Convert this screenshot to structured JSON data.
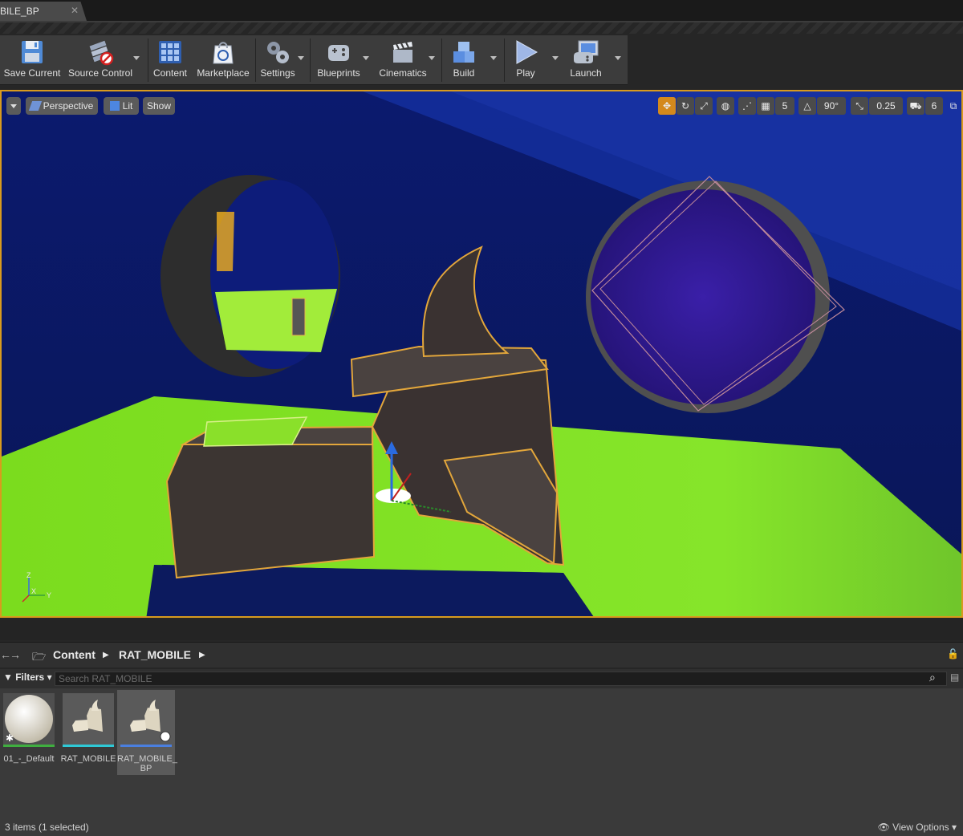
{
  "tab": {
    "title": "BILE_BP",
    "close": "✕"
  },
  "toolbar": {
    "buttons": [
      {
        "label": "Save Current",
        "icon": "save-icon"
      },
      {
        "label": "Source Control",
        "icon": "source-control-icon"
      },
      {
        "label": "Content",
        "icon": "content-icon"
      },
      {
        "label": "Marketplace",
        "icon": "marketplace-icon"
      },
      {
        "label": "Settings",
        "icon": "settings-icon"
      },
      {
        "label": "Blueprints",
        "icon": "blueprints-icon"
      },
      {
        "label": "Cinematics",
        "icon": "cinematics-icon"
      },
      {
        "label": "Build",
        "icon": "build-icon"
      },
      {
        "label": "Play",
        "icon": "play-icon"
      },
      {
        "label": "Launch",
        "icon": "launch-icon"
      }
    ]
  },
  "viewport": {
    "view_mode": "Perspective",
    "lighting": "Lit",
    "show": "Show",
    "grid_snap": "5",
    "rotation_snap": "90°",
    "scale_snap": "0.25",
    "camera_speed": "6",
    "axis": {
      "z": "Z",
      "x": "X",
      "y": "Y"
    }
  },
  "content_browser": {
    "path": [
      "Content",
      "RAT_MOBILE"
    ],
    "filters_label": "Filters",
    "search_placeholder": "Search RAT_MOBILE",
    "assets": [
      {
        "name": "01_-_Default",
        "type_color": "#3fae3f",
        "selected": false
      },
      {
        "name": "RAT_MOBILE",
        "type_color": "#2ec9d6",
        "selected": false
      },
      {
        "name": "RAT_MOBILE_\nBP",
        "type_color": "#4a7fe0",
        "selected": true
      }
    ],
    "status": "3 items (1 selected)",
    "view_options": "View Options"
  }
}
